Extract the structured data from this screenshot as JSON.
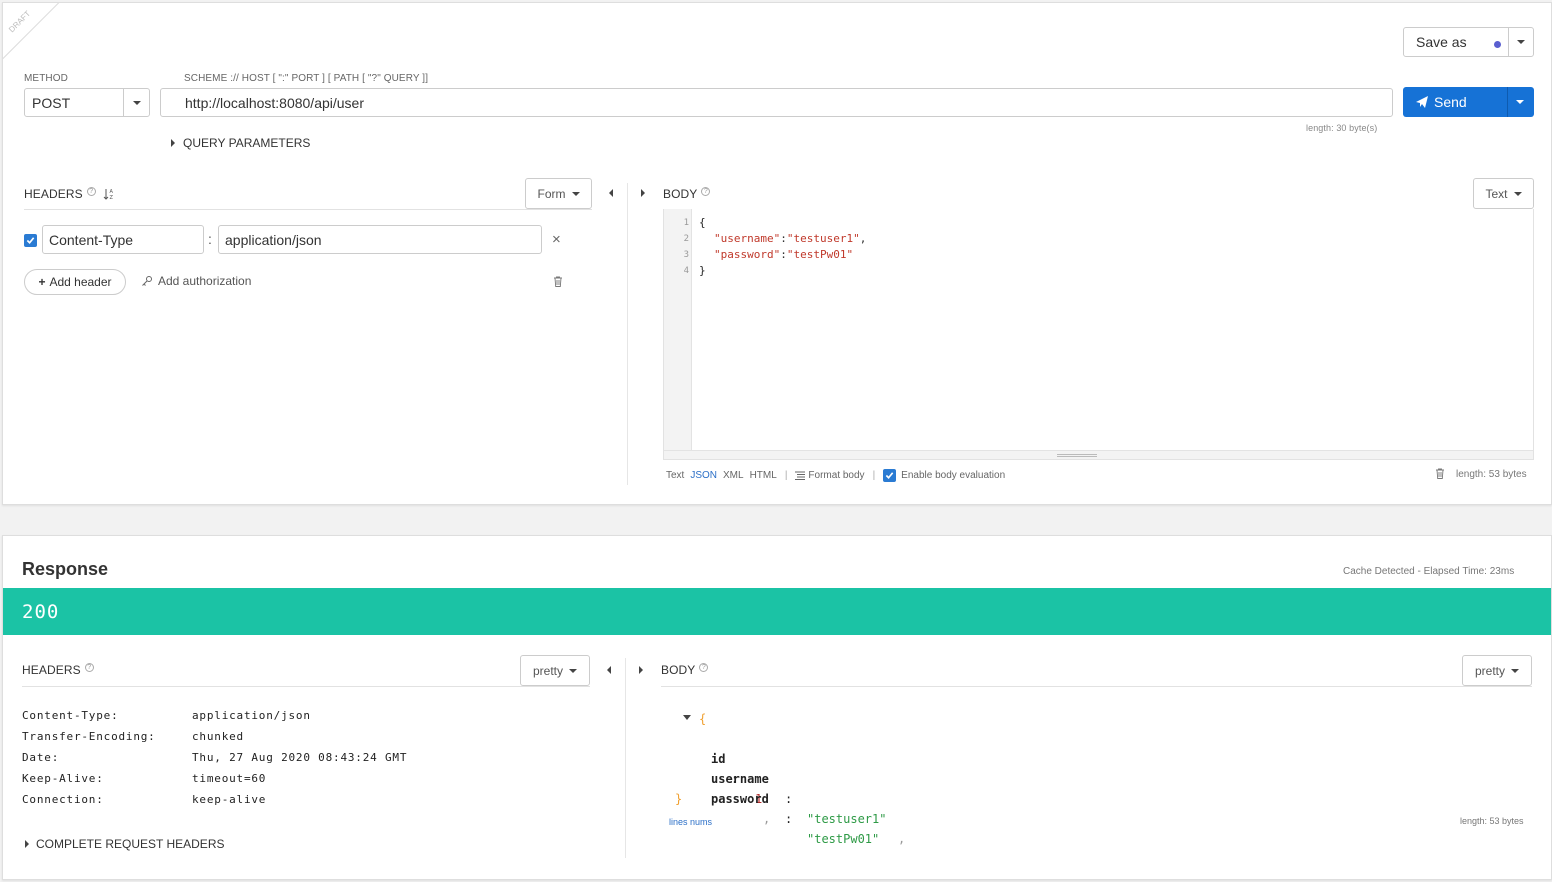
{
  "request": {
    "draft_label": "DRAFT",
    "save_as_label": "Save as",
    "method_label": "METHOD",
    "method_value": "POST",
    "url_hint": "SCHEME :// HOST [ \":\" PORT ] [ PATH [ \"?\" QUERY ]]",
    "url_value": "http://localhost:8080/api/user",
    "url_length": "length: 30 byte(s)",
    "send_label": "Send",
    "query_params_label": "QUERY PARAMETERS",
    "headers": {
      "title": "HEADERS",
      "mode": "Form",
      "rows": [
        {
          "enabled": true,
          "name": "Content-Type",
          "value": "application/json"
        }
      ],
      "separator": ":",
      "add_header_label": "Add header",
      "add_authorization_label": "Add authorization"
    },
    "body": {
      "title": "BODY",
      "mode": "Text",
      "lines": [
        {
          "num": "1",
          "text": "{"
        },
        {
          "num": "2",
          "key": "\"username\"",
          "colon": ":",
          "val": "\"testuser1\"",
          "tail": ","
        },
        {
          "num": "3",
          "key": "\"password\"",
          "colon": ":",
          "val": "\"testPw01\"",
          "tail": ""
        },
        {
          "num": "4",
          "text": "}"
        }
      ],
      "formats": [
        "Text",
        "JSON",
        "XML",
        "HTML"
      ],
      "active_format": "JSON",
      "format_body_label": "Format body",
      "enable_eval_label": "Enable body evaluation",
      "length": "length: 53 bytes"
    }
  },
  "response": {
    "title": "Response",
    "meta": "Cache Detected - Elapsed Time: 23ms",
    "status_code": "200",
    "status_color": "#1bc3a5",
    "headers": {
      "title": "HEADERS",
      "mode": "pretty",
      "rows": [
        {
          "key": "Content-Type:",
          "value": "application/json"
        },
        {
          "key": "Transfer-Encoding:",
          "value": "chunked"
        },
        {
          "key": "Date:",
          "value": "Thu, 27 Aug 2020 08:43:24 GMT"
        },
        {
          "key": "Keep-Alive:",
          "value": "timeout=60"
        },
        {
          "key": "Connection:",
          "value": "keep-alive"
        }
      ],
      "complete_label": "COMPLETE REQUEST HEADERS"
    },
    "body": {
      "title": "BODY",
      "mode": "pretty",
      "open_brace": "{",
      "close_brace": "}",
      "fields": [
        {
          "key": "id",
          "value": "1",
          "type": "number",
          "tail": ","
        },
        {
          "key": "username",
          "value": "\"testuser1\"",
          "type": "string",
          "tail": ","
        },
        {
          "key": "password",
          "value": "\"testPw01\"",
          "type": "string",
          "tail": ""
        }
      ],
      "lines_nums_label": "lines nums",
      "length": "length: 53 bytes"
    }
  }
}
